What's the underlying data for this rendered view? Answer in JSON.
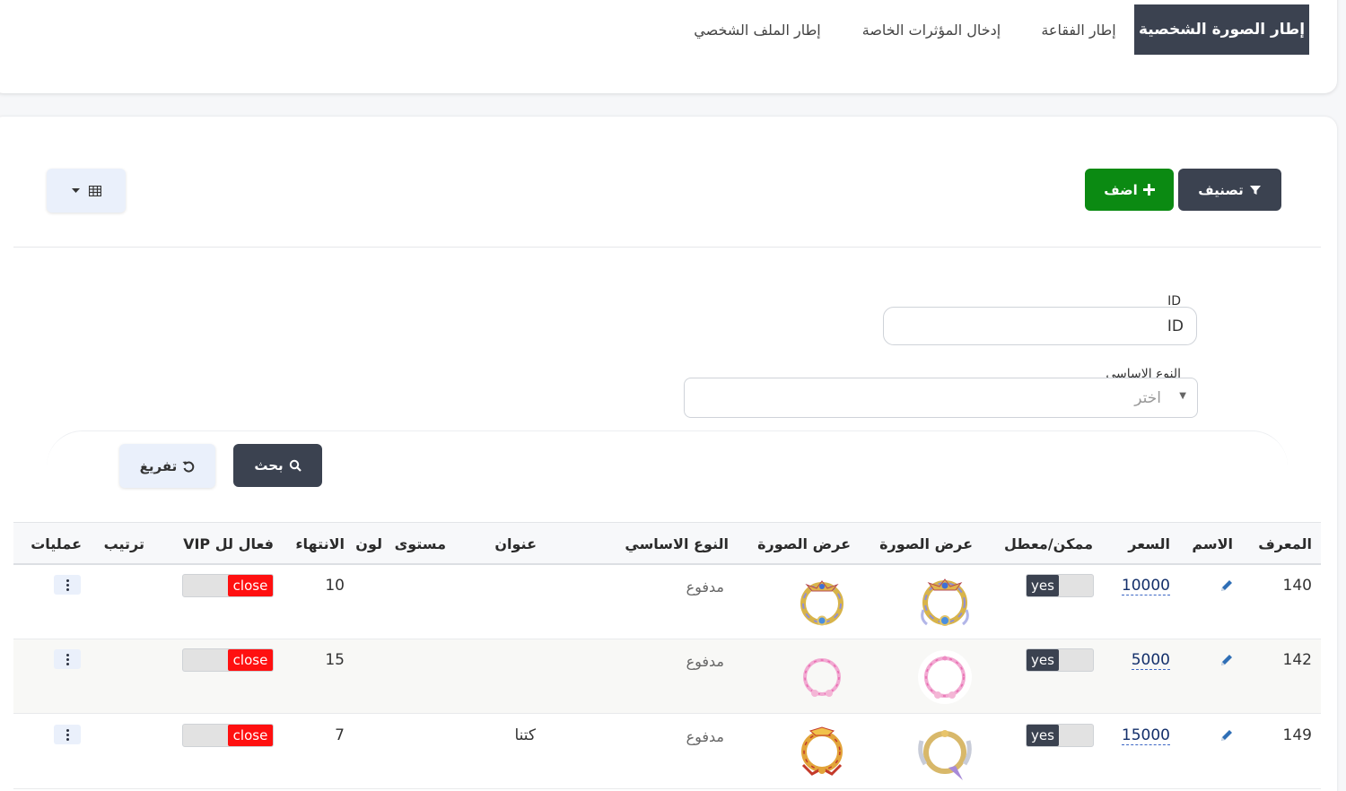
{
  "tabs": [
    {
      "label": "إطار الصورة الشخصية",
      "active": true
    },
    {
      "label": "إطار الفقاعة",
      "active": false
    },
    {
      "label": "إدخال المؤثرات الخاصة",
      "active": false
    },
    {
      "label": "إطار الملف الشخصي",
      "active": false
    }
  ],
  "toolbar": {
    "filter_label": "تصنيف",
    "add_label": "اضف",
    "columns_menu_icon": "table-icon"
  },
  "filters": {
    "id_label": "ID",
    "id_value": "ID",
    "base_type_label": "النوع الاساسي",
    "base_type_placeholder": "اختر",
    "search_label": "بحث",
    "reset_label": "تفريغ"
  },
  "table": {
    "headers": {
      "id": "المعرف",
      "name": "الاسم",
      "price": "السعر",
      "enabled": "ممكن/معطل",
      "image1": "عرض الصورة",
      "image2": "عرض الصورة",
      "base_type": "النوع الاساسي",
      "title": "عنوان",
      "level": "مستوى",
      "color": "لون",
      "expiry": "الانتهاء",
      "vip": "VIP فعال لل",
      "order": "ترتيب",
      "actions": "عمليات"
    },
    "rows": [
      {
        "id": "140",
        "price": "10000",
        "enabled": "yes",
        "base_type": "مدفوع",
        "title": "",
        "expiry": "10",
        "vip": "close",
        "frame_style": "gold-blue"
      },
      {
        "id": "142",
        "price": "5000",
        "enabled": "yes",
        "base_type": "مدفوع",
        "title": "",
        "expiry": "15",
        "vip": "close",
        "frame_style": "pink"
      },
      {
        "id": "149",
        "price": "15000",
        "enabled": "yes",
        "base_type": "مدفوع",
        "title": "كتنا",
        "expiry": "7",
        "vip": "close",
        "frame_style": "gold-red"
      }
    ]
  },
  "colors": {
    "dark": "#3b4250",
    "green": "#0b8a12",
    "danger": "#ff1010",
    "link": "#14306b"
  }
}
